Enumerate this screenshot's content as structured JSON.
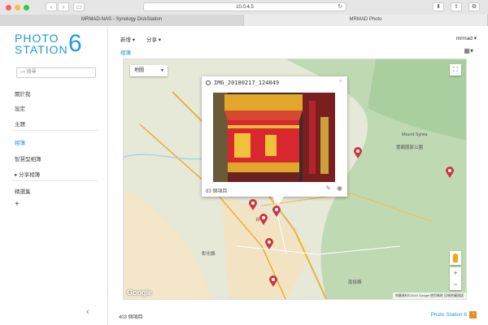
{
  "browser": {
    "url": "10.0.4.5",
    "tabs": [
      {
        "label": "MRMAD-NAS - Synology DiskStation"
      },
      {
        "label": "MRMAD Photo"
      }
    ]
  },
  "logo": {
    "line1": "PHOTO",
    "line2": "STATION",
    "number": "6"
  },
  "search": {
    "placeholder": "搜尋"
  },
  "sidebar": {
    "items": [
      {
        "label": "關於我"
      },
      {
        "label": "設定"
      },
      {
        "label": "主題"
      },
      {
        "label": "相簿"
      },
      {
        "label": "智慧型相簿"
      },
      {
        "label": "▸ 分享相簿"
      },
      {
        "label": "精選集"
      },
      {
        "label": "+"
      }
    ]
  },
  "toolbar": {
    "new_label": "新增 ▾",
    "share_label": "分享 ▾",
    "user": "mrmad ▾"
  },
  "breadcrumb": "相簿",
  "map": {
    "type_label": "地圖",
    "attribution": "地圖資料©2019 Google  使用條款  回報地圖錯誤",
    "google": "Google",
    "places": [
      {
        "name": "Mount Sylvia"
      },
      {
        "name": "雪霸國家公園"
      },
      {
        "name": "台中"
      },
      {
        "name": "彰化縣"
      },
      {
        "name": "南投縣"
      }
    ]
  },
  "info_window": {
    "title": "IMG_20180217_124849",
    "count": "83 個項目"
  },
  "footer": {
    "count": "403 個項目",
    "brand": "Photo Station 6"
  },
  "colors": {
    "accent": "#1f9ad6",
    "pin": "#d0343f"
  }
}
